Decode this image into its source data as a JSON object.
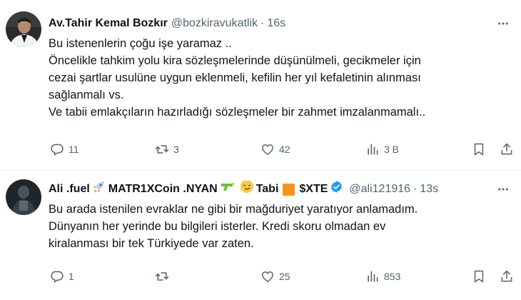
{
  "tweets": [
    {
      "name": "Av.Tahir Kemal Bozkır",
      "handle": "@bozkiravukatlik",
      "separator": "·",
      "time": "16s",
      "lines": [
        "Bu istenenlerin çoğu işe yaramaz ..",
        "Öncelikle tahkim yolu kira sözleşmelerinde düşünülmeli, gecikmeler için",
        "cezai şartlar usulüne uygun eklenmeli, kefilin her yıl kefaletinin alınması",
        "sağlanmalı vs.",
        "Ve tabii emlakçıların hazırladığı sözleşmeler bir zahmet imzalanmamalı.."
      ],
      "replies": "11",
      "retweets": "3",
      "likes": "42",
      "views": "3 B"
    },
    {
      "name_parts": [
        "Ali .fuel",
        "MATR1XCoin .NYAN",
        "Tabi",
        "$XTE"
      ],
      "emojis": [
        "rocket-emoji",
        "water-pistol-emoji",
        "smirking-face-emoji",
        "orange-square-emoji"
      ],
      "handle": "@ali121916",
      "separator": "·",
      "time": "13s",
      "verified": true,
      "lines": [
        "Bu arada istenilen evraklar ne gibi bir mağduriyet yaratıyor anlamadım.",
        "Dünyanın her yerinde bu bilgileri isterler. Kredi skoru olmadan ev",
        "kiralanması bir tek Türkiyede var zaten."
      ],
      "replies": "1",
      "retweets": "",
      "likes": "25",
      "views": "853"
    }
  ],
  "colors": {
    "text": "#0f1419",
    "secondary": "#536471",
    "verified": "#1d9bf0",
    "divider": "#eff3f4"
  },
  "icons": [
    "more-icon",
    "reply-icon",
    "retweet-icon",
    "like-icon",
    "views-icon",
    "bookmark-icon",
    "share-icon",
    "verified-badge-icon"
  ]
}
